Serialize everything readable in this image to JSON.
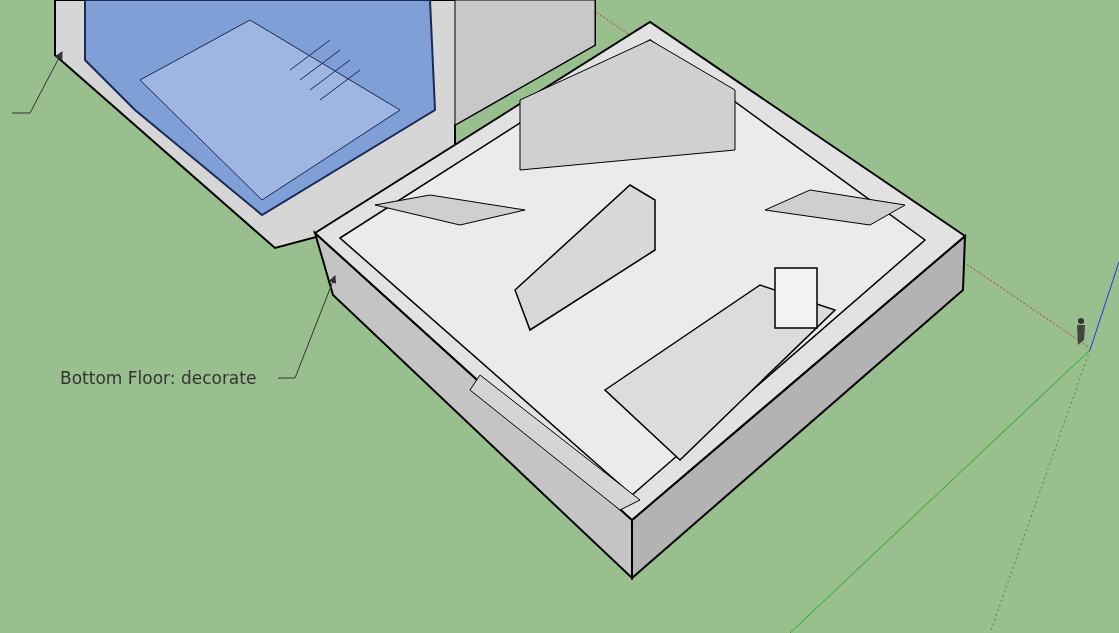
{
  "viewport": {
    "labels": [
      {
        "text": "Bottom Floor: decorate"
      }
    ]
  }
}
